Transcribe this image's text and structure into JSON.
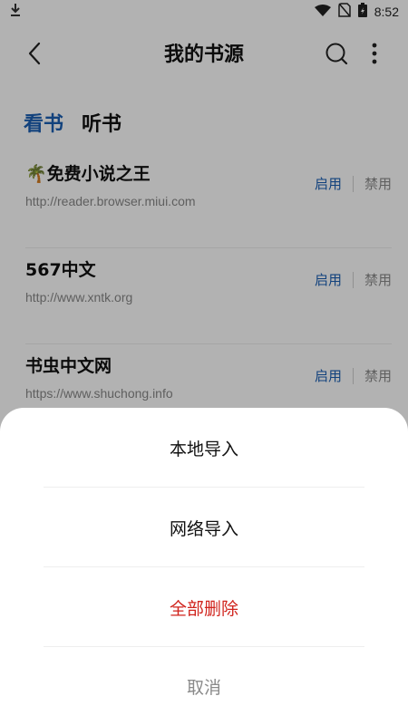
{
  "status_bar": {
    "time": "8:52",
    "icons": [
      "download-icon",
      "wifi-icon",
      "no-sim-icon",
      "battery-icon"
    ]
  },
  "header": {
    "title": "我的书源",
    "back_icon": "chevron-left-icon",
    "search_icon": "search-icon",
    "more_icon": "more-vertical-icon"
  },
  "tabs": [
    {
      "label": "看书",
      "active": true
    },
    {
      "label": "听书",
      "active": false
    }
  ],
  "sources": [
    {
      "name": "🌴免费小说之王",
      "url": "http://reader.browser.miui.com",
      "enable": "启用",
      "disable": "禁用"
    },
    {
      "name": "567中文",
      "url": "http://www.xntk.org",
      "enable": "启用",
      "disable": "禁用"
    },
    {
      "name": "书虫中文网",
      "url": "https://www.shuchong.info",
      "enable": "启用",
      "disable": "禁用"
    }
  ],
  "bottom_sheet": {
    "local_import": "本地导入",
    "network_import": "网络导入",
    "delete_all": "全部删除",
    "cancel": "取消"
  },
  "colors": {
    "accent": "#1a5fb4",
    "danger": "#d0231c",
    "muted": "#8a8a8a"
  }
}
